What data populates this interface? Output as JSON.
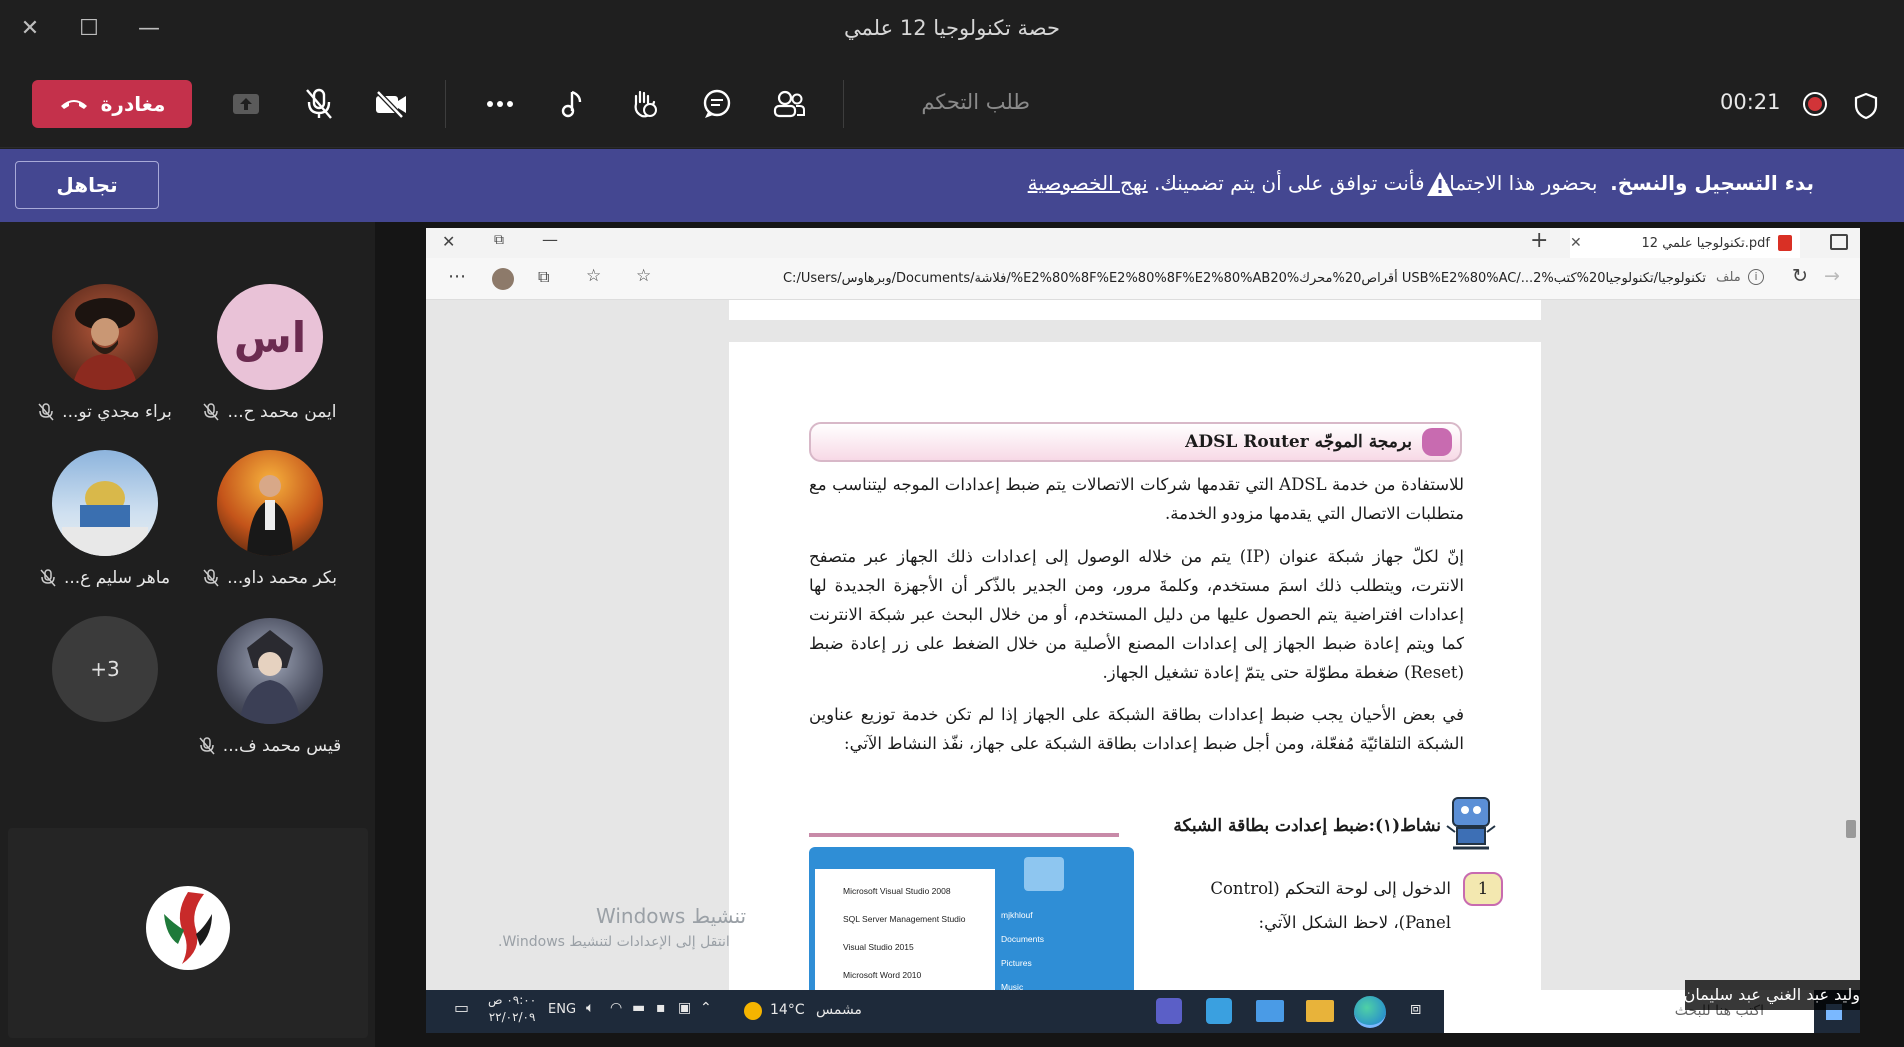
{
  "window": {
    "title": "حصة تكنولوجيا 12 علمي"
  },
  "toolbar": {
    "leave_label": "مغادرة",
    "request_control_label": "طلب التحكم",
    "timer": "00:21"
  },
  "banner": {
    "ignore_label": "تجاهل",
    "bold_text": "بدء التسجيل والنسخ.",
    "body_text": "بحضور هذا الاجتماع، فأنت توافق على أن يتم تضمينك.",
    "link_text": "نهج الخصوصية"
  },
  "participants": [
    {
      "name": "ايمن محمد ح...",
      "initials": "اس"
    },
    {
      "name": "براء مجدي تو..."
    },
    {
      "name": "بكر محمد داو..."
    },
    {
      "name": "ماهر سليم ع..."
    },
    {
      "name": "قيس محمد ف..."
    }
  ],
  "more_participants": "+3",
  "browser": {
    "tab_title": "تكنولوجيا علمي 12.pdf",
    "url": "C:/Users/وبرهاوس/Documents/فلاشة/%E2%80%8F%E2%80%8F%E2%80%AB20%أقراص20%محرك USB%E2%80%AC/...2%تكنولوجيا/تكنولوجيا20%كتب",
    "file_label": "ملف"
  },
  "pdf": {
    "section_title": "برمجة الموجّه ADSL Router",
    "paragraph1": "للاستفادة من خدمة ADSL التي تقدمها شركات الاتصالات يتم ضبط إعدادات الموجه ليتناسب مع متطلبات الاتصال التي يقدمها مزودو الخدمة.",
    "paragraph2": "إنّ لكلّ جهاز شبكة عنوان (IP) يتم من خلاله الوصول إلى إعدادات ذلك الجهاز عبر متصفح الانترت، ويتطلب ذلك اسمَ مستخدم، وكلمةَ مرور، ومن الجدير بالذّكر أن الأجهزة الجديدة لها إعدادات افتراضية يتم الحصول عليها من دليل المستخدم، أو من خلال البحث عبر شبكة الانترنت كما ويتم إعادة ضبط الجهاز إلى إعدادات المصنع الأصلية من خلال الضغط على زر إعادة ضبط (Reset) ضغطة مطوّلة حتى يتمّ إعادة تشغيل الجهاز.",
    "paragraph3": "في بعض الأحيان يجب ضبط إعدادات بطاقة الشبكة على الجهاز إذا لم تكن خدمة توزيع عناوين الشبكة التلقائيّة مُفعّلة، ومن أجل ضبط إعدادات بطاقة الشبكة على جهاز، نفّذ النشاط الآتي:",
    "activity_title": "نشاط(١):ضبط إعدادت بطاقة الشبكة",
    "step_number": "1",
    "step1_line1": "الدخول إلى لوحة التحكم (Control",
    "step1_line2": "Panel)، لاحظ الشكل الآتي:",
    "start_menu_items": [
      "Microsoft Visual Studio 2008",
      "SQL Server Management Studio",
      "Visual Studio 2015",
      "Microsoft Word 2010"
    ],
    "start_menu_right": [
      "mjkhlouf",
      "Documents",
      "Pictures",
      "Music"
    ]
  },
  "watermark": {
    "line1": "تنشيط Windows",
    "line2": "انتقل إلى الإعدادات لتنشيط Windows."
  },
  "taskbar": {
    "time": "٠٩:٠٠ ص",
    "date": "٢٢/٠٢/٠٩",
    "lang": "ENG",
    "weather": "14°C",
    "weather_label": "مشمس",
    "search_placeholder": "اكتب هنا للبحث"
  },
  "presenter_name": "وليد عبد الغني عبد سليمان"
}
